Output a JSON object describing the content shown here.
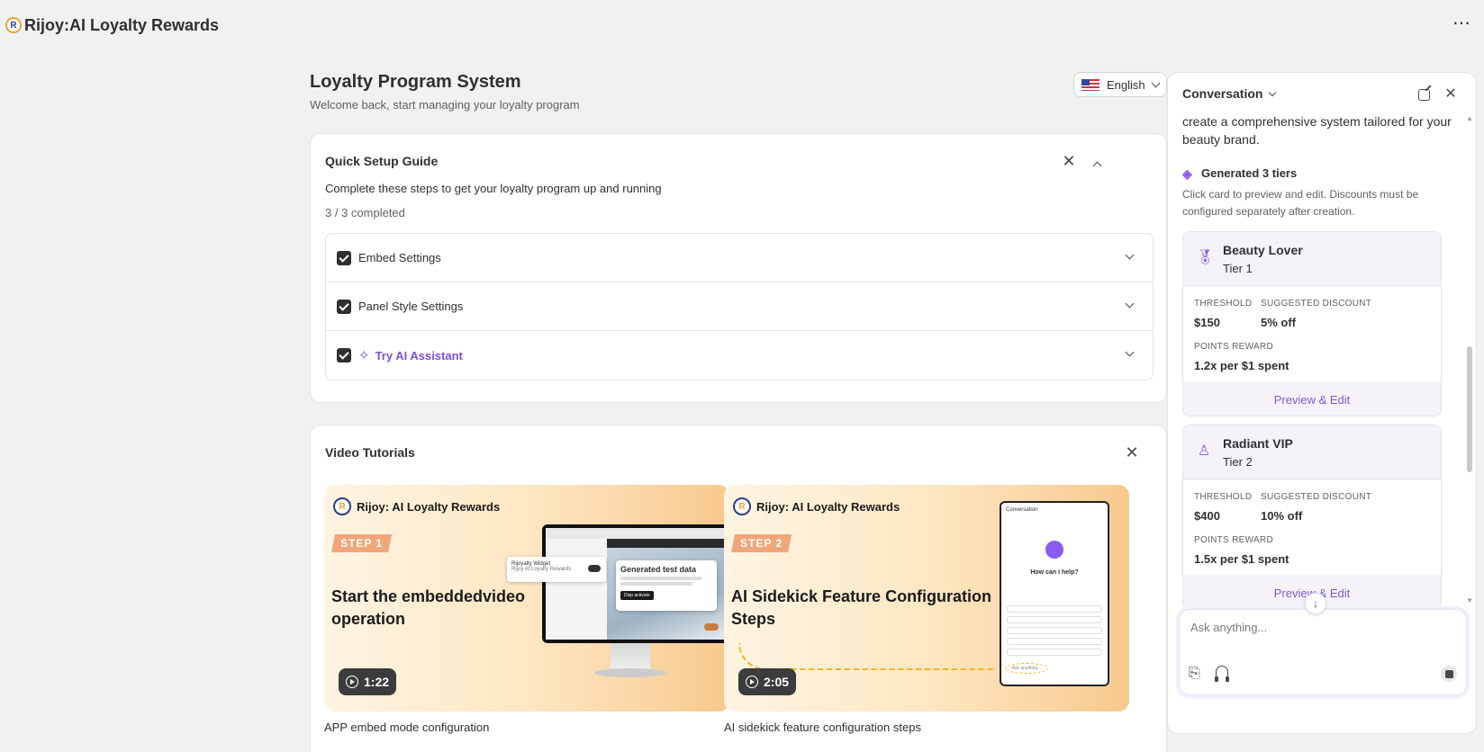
{
  "app": {
    "title": "Rijoy:AI Loyalty Rewards",
    "logo_letter": "R",
    "more_icon": "⋯"
  },
  "page": {
    "title": "Loyalty Program System",
    "subtitle": "Welcome back, start managing your loyalty program",
    "language": "English"
  },
  "setup": {
    "title": "Quick Setup Guide",
    "description": "Complete these steps to get your loyalty program up and running",
    "progress": "3 / 3 completed",
    "steps": [
      {
        "label": "Embed Settings",
        "checked": true
      },
      {
        "label": "Panel Style Settings",
        "checked": true
      },
      {
        "label": "Try AI Assistant",
        "checked": true
      }
    ]
  },
  "videos": {
    "title": "Video Tutorials",
    "items": [
      {
        "brand": "Rijoy: AI Loyalty Rewards",
        "step": "STEP 1",
        "headline": "Start the embeddedvideo operation",
        "duration": "1:22",
        "caption": "APP embed mode configuration",
        "popup_title": "Rijoyalty Widget",
        "popup_sub": "Rijoy AI Loyalty Rewards",
        "screen_title": "Generated test data",
        "screen_button": "Disp activate"
      },
      {
        "brand": "Rijoy: AI Loyalty Rewards",
        "step": "STEP 2",
        "headline": "AI Sidekick Feature Configuration Steps",
        "duration": "2:05",
        "caption": "AI sidekick feature configuration steps",
        "phone_header": "Conversation",
        "phone_question": "How can I help?",
        "phone_input": "Ask anything..."
      }
    ]
  },
  "conversation": {
    "title": "Conversation",
    "intro": "create a comprehensive system tailored for your beauty brand.",
    "generated_title": "Generated 3 tiers",
    "generated_desc": "Click card to preview and edit. Discounts must be configured separately after creation.",
    "tiers": [
      {
        "name": "Beauty Lover",
        "level": "Tier 1",
        "threshold_label": "THRESHOLD",
        "threshold": "$150",
        "discount_label": "SUGGESTED DISCOUNT",
        "discount": "5% off",
        "points_label": "POINTS REWARD",
        "points": "1.2x per $1 spent",
        "action": "Preview & Edit"
      },
      {
        "name": "Radiant VIP",
        "level": "Tier 2",
        "threshold_label": "THRESHOLD",
        "threshold": "$400",
        "discount_label": "SUGGESTED DISCOUNT",
        "discount": "10% off",
        "points_label": "POINTS REWARD",
        "points": "1.5x per $1 spent",
        "action": "Preview & Edit"
      }
    ],
    "input_placeholder": "Ask anything..."
  },
  "colors": {
    "accent_purple": "#7a4fd6",
    "checkbox": "#303030",
    "background": "#f1f1f1"
  }
}
